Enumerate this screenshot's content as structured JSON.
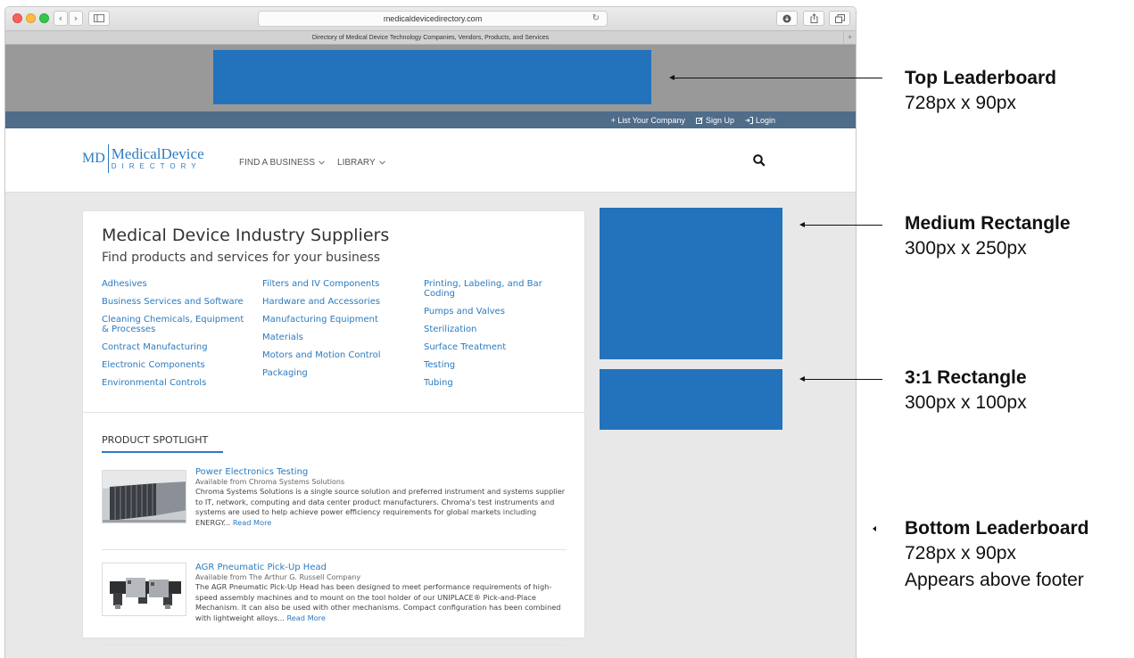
{
  "browser": {
    "address": "medicaldevicedirectory.com",
    "tab_title": "Directory of Medical Device Technology Companies, Vendors, Products, and Services",
    "tab_plus": "+"
  },
  "utility_bar": {
    "list_company": "+ List Your Company",
    "sign_up": "Sign Up",
    "login": "Login"
  },
  "logo": {
    "md": "MD",
    "title": "MedicalDevice",
    "subtitle": "DIRECTORY"
  },
  "nav": {
    "find_business": "FIND A BUSINESS",
    "library": "LIBRARY"
  },
  "main": {
    "heading": "Medical Device Industry Suppliers",
    "subheading": "Find products and services for your business",
    "categories": [
      [
        "Adhesives",
        "Business Services and Software",
        "Cleaning Chemicals, Equipment & Processes",
        "Contract Manufacturing",
        "Electronic Components",
        "Environmental Controls"
      ],
      [
        "Filters and IV Components",
        "Hardware and Accessories",
        "Manufacturing Equipment",
        "Materials",
        "Motors and Motion Control",
        "Packaging"
      ],
      [
        "Printing, Labeling, and Bar Coding",
        "Pumps and Valves",
        "Sterilization",
        "Surface Treatment",
        "Testing",
        "Tubing"
      ]
    ],
    "spotlight_title": "PRODUCT SPOTLIGHT",
    "products": [
      {
        "title": "Power Electronics Testing",
        "from": "Available from Chroma Systems Solutions",
        "desc": "Chroma Systems Solutions is a single source solution and preferred instrument and systems supplier to IT, network, computing and data center product manufacturers. Chroma's test instruments and systems are used to help achieve power efficiency requirements for global markets including ENERGY...",
        "more": "Read More"
      },
      {
        "title": "AGR Pneumatic Pick-Up Head",
        "from": "Available from The Arthur G. Russell Company",
        "desc": "The AGR Pneumatic Pick-Up Head has been designed to meet performance requirements of high-speed assembly machines and to mount on the tool holder of our UNIPLACE® Pick-and-Place Mechanism. It can also be used with other mechanisms. Compact configuration has been combined with lightweight alloys...",
        "more": "Read More"
      }
    ]
  },
  "annotations": [
    {
      "title": "Top Leaderboard",
      "lines": [
        "728px x 90px"
      ]
    },
    {
      "title": "Medium Rectangle",
      "lines": [
        "300px x 250px"
      ]
    },
    {
      "title": "3:1 Rectangle",
      "lines": [
        "300px x 100px"
      ]
    },
    {
      "title": "Bottom Leaderboard",
      "lines": [
        "728px x 90px",
        "Appears above footer"
      ]
    }
  ],
  "colors": {
    "ad_blue": "#2372bc",
    "link_blue": "#2b7bbf",
    "util_bar": "#4f6c89"
  }
}
